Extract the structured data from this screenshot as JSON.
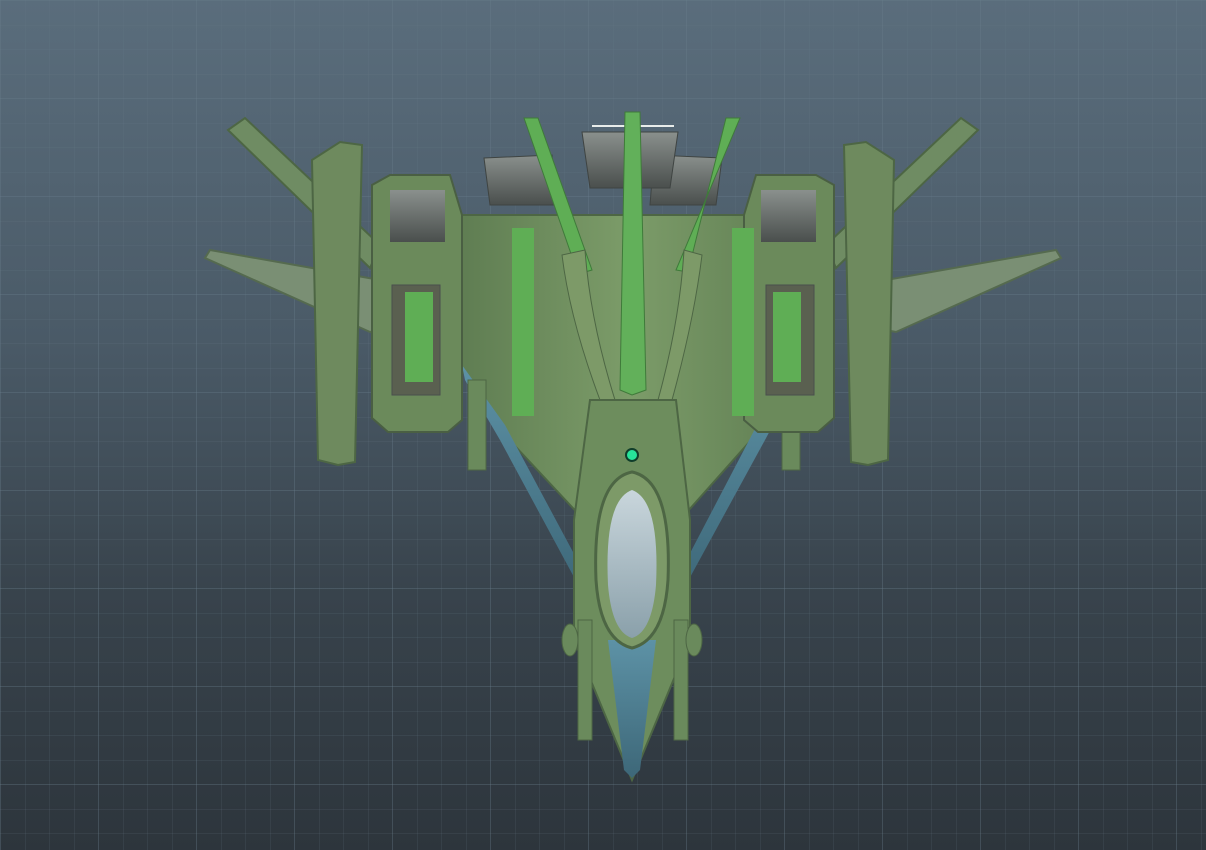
{
  "viewport": {
    "view": "top",
    "grid": true,
    "background_color": "#4a5a67",
    "grid_color": "#6b7d8c"
  },
  "model": {
    "name_icon": "spaceship-model",
    "palette": {
      "hull": "#6e8f5e",
      "hull_dark": "#4d6644",
      "hull_light": "#8fae7a",
      "accent_green": "#5fae55",
      "accent_blue": "#4a7f93",
      "cockpit_glass": "#b9cbd3",
      "metal": "#6c7270",
      "metal_dark": "#4a4f4d"
    }
  },
  "pivot": {
    "icon": "pivot-point-icon",
    "color": "#27e49a"
  }
}
